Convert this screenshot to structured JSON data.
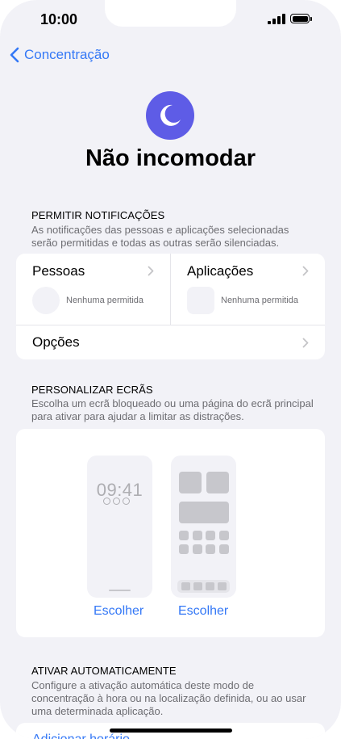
{
  "status_bar": {
    "time": "10:00"
  },
  "nav": {
    "back_label": "Concentração"
  },
  "header": {
    "title": "Não incomodar"
  },
  "notifications": {
    "header": "PERMITIR NOTIFICAÇÕES",
    "description": "As notificações das pessoas e aplicações selecionadas serão permitidas e todas as outras serão silenciadas.",
    "people_label": "Pessoas",
    "people_status": "Nenhuma permitida",
    "apps_label": "Aplicações",
    "apps_status": "Nenhuma permitida",
    "options_label": "Opções"
  },
  "customize": {
    "header": "PERSONALIZAR ECRÃS",
    "description": "Escolha um ecrã bloqueado ou uma página do ecrã principal para ativar para ajudar a limitar as distrações.",
    "lock_preview_time": "09:41",
    "choose_lock_label": "Escolher",
    "choose_home_label": "Escolher"
  },
  "automation": {
    "header": "ATIVAR AUTOMATICAMENTE",
    "description": "Configure a ativação automática deste modo de concentração à hora ou na localização definida, ou ao usar uma determinada aplicação.",
    "add_schedule_label": "Adicionar horário"
  },
  "colors": {
    "accent": "#3478f6",
    "focus_icon_bg": "#5e5ce6",
    "background": "#f2f2f7"
  },
  "icons": {
    "back": "chevron-left-icon",
    "focus": "moon-icon",
    "disclosure": "chevron-right-icon"
  }
}
